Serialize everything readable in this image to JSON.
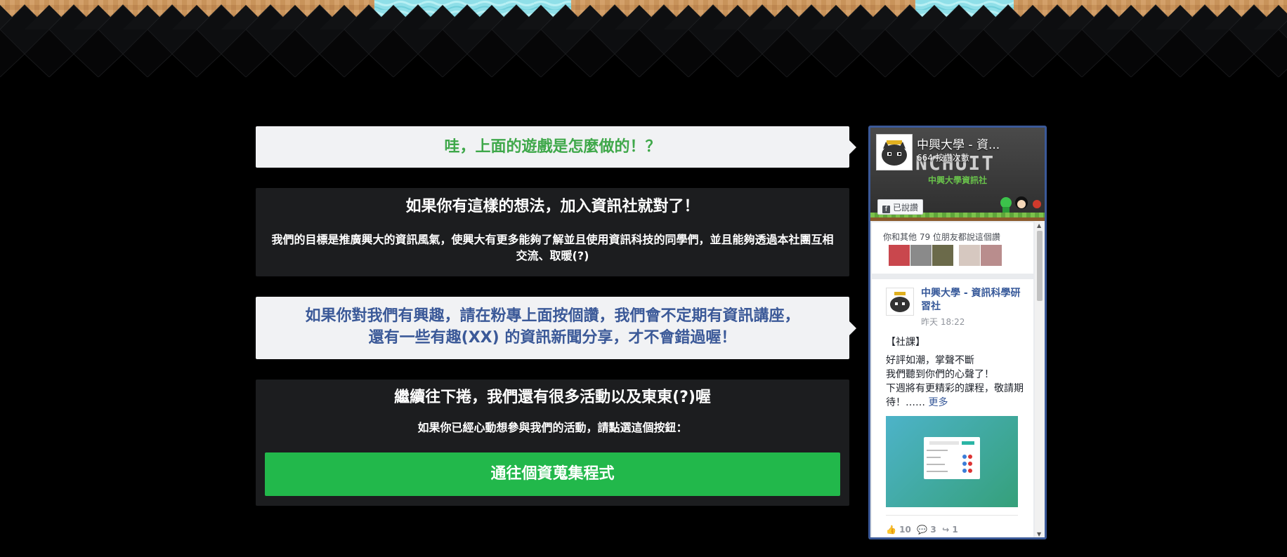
{
  "colors": {
    "page_bg": "#000000",
    "card_light": "#f1f2f4",
    "card_dark": "#1c1d1f",
    "title_green": "#3fa84a",
    "title_blue": "#3b5998",
    "button_green": "#22b84b",
    "banner_dirt": "#c8935a",
    "banner_water": "#8fdfe8",
    "fb_border": "#3b5998",
    "fb_link": "#365899"
  },
  "cards": {
    "question_title": "哇，上面的遊戲是怎麼做的！？",
    "join_heading": "如果你有這樣的想法，加入資訊社就對了！",
    "join_text": "我們的目標是推廣興大的資訊風氣，使興大有更多能夠了解並且使用資訊科技的同學們，並且能夠透過本社團互相交流、取暖(?)",
    "like_line1": "如果你對我們有興趣，請在粉專上面按個讚，我們會不定期有資訊講座，",
    "like_line2": "還有一些有趣(XX) 的資訊新聞分享，才不會錯過喔！",
    "scroll_heading": "繼續往下捲，我們還有很多活動以及東東(?)喔",
    "scroll_text": "如果你已經心動想參與我們的活動，請點選這個按鈕：",
    "button_label": "通往個資蒐集程式"
  },
  "facebook": {
    "page_name": "中興大學 - 資...",
    "likes_count": "664 按讚次數",
    "cover_logo_text": "NCHUIT",
    "cover_sub_text": "中興大學資訊社",
    "liked_button": "已說讚",
    "friends_text": "你和其他 79 位朋友都說這個讚",
    "post": {
      "page_name": "中興大學 - 資訊科學研習社",
      "time": "昨天 18:22",
      "line1": "【社課】",
      "line2": "好評如潮，掌聲不斷",
      "line3": "我們聽到你們的心聲了！",
      "line4": "下週將有更精彩的課程，敬請期待！……",
      "more": "更多",
      "likes": "10",
      "comments": "3",
      "shares": "1"
    }
  },
  "icons": {
    "fb_logo": "facebook-f-icon",
    "like": "thumbs-up-icon",
    "comment": "comment-icon",
    "share": "share-arrow-icon"
  }
}
